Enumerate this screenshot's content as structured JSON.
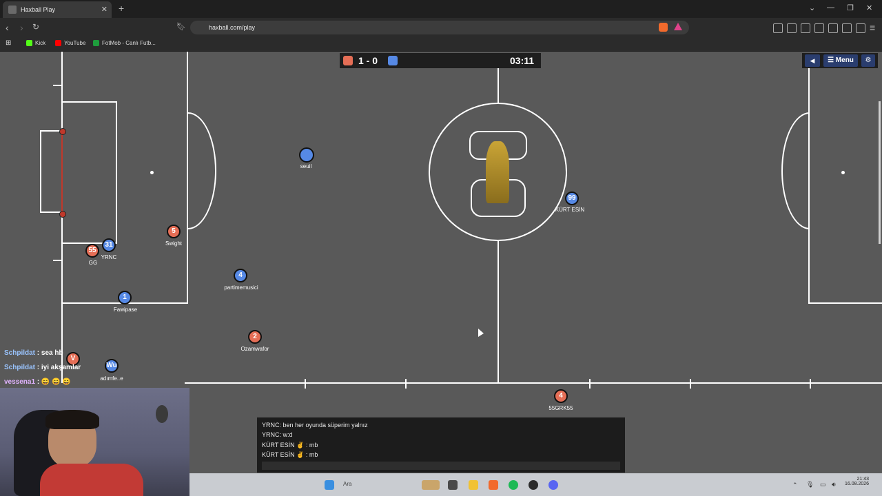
{
  "browser": {
    "tab_title": "Haxball Play",
    "tab_close": "✕",
    "new_tab": "+",
    "url": "haxball.com/play",
    "bookmarks": [
      {
        "label": "Kick",
        "color": "#53fc18"
      },
      {
        "label": "YouTube",
        "color": "#ff0000"
      },
      {
        "label": "FotMob - Canlı Futb...",
        "color": "#1e9c3c"
      }
    ]
  },
  "scoreboard": {
    "score": "1 - 0",
    "time": "03:11",
    "red_color": "#e56e56",
    "blue_color": "#5689e5"
  },
  "menu": {
    "menu_label": "☰ Menu",
    "sound_icon": "◀",
    "gear_icon": "⚙"
  },
  "players": [
    {
      "team": "blue",
      "number": "",
      "name": "seuil"
    },
    {
      "team": "blue",
      "number": "99",
      "name": "KÜRT ESİN"
    },
    {
      "team": "red",
      "number": "5",
      "name": "Swight"
    },
    {
      "team": "red",
      "number": "55",
      "name": "GG"
    },
    {
      "team": "blue",
      "number": "31",
      "name": "YRNC"
    },
    {
      "team": "blue",
      "number": "4",
      "name": "partimemusici"
    },
    {
      "team": "blue",
      "number": "1",
      "name": "Fawipase"
    },
    {
      "team": "red",
      "number": "2",
      "name": "Ozamwafor"
    },
    {
      "team": "red",
      "number": "V",
      "name": ""
    },
    {
      "team": "blue",
      "number": "Wu",
      "name": "adımfe..e"
    },
    {
      "team": "red",
      "number": "4",
      "name": "55GRK55"
    }
  ],
  "overlay_chat": [
    {
      "user": "Schpildat",
      "message": ": sea hb"
    },
    {
      "user": "Schpildat",
      "message": ": iyi akşamlar"
    },
    {
      "user": "vessena1",
      "message": ": 😄 😄 😄"
    }
  ],
  "chat": [
    "YRNC: ben her oyunda süperim yalnız",
    "YRNC: w:d",
    "KÜRT ESİN ✌ : mb",
    "KÜRT ESİN ✌ : mb"
  ],
  "taskbar": {
    "search": "Ara",
    "time": "21:43",
    "date": "16.08.2026"
  }
}
